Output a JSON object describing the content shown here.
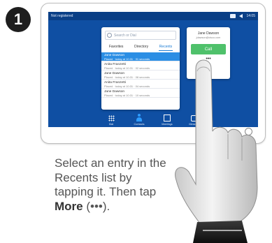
{
  "step": {
    "number": "1"
  },
  "tablet": {
    "status_bar": {
      "left": "Not registered",
      "time": "14:05"
    },
    "search": {
      "placeholder": "Search or Dial"
    },
    "tabs": [
      {
        "label": "Favorites",
        "active": false
      },
      {
        "label": "Directory",
        "active": false
      },
      {
        "label": "Recents",
        "active": true
      }
    ],
    "recents": [
      {
        "name": "Jane Dawson",
        "detail": "Placed · today at 10:31 · 01 seconds",
        "selected": true
      },
      {
        "name": "Anita Franzetti",
        "detail": "Placed · today at 10:31 · 02 seconds",
        "selected": false
      },
      {
        "name": "Jane Dawson",
        "detail": "Placed · today at 10:31 · 08 seconds",
        "selected": false
      },
      {
        "name": "Anita Franzetti",
        "detail": "Placed · today at 10:31 · 04 seconds",
        "selected": false
      },
      {
        "name": "Jane Dawson",
        "detail": "Placed · today at 10:31 · 10 seconds",
        "selected": false
      }
    ],
    "contact_card": {
      "name": "Jane Dawson",
      "uri": "jdawson@cisco.com",
      "call_label": "Call",
      "more_label": "•••"
    },
    "dock": [
      {
        "label": "Dial",
        "icon": "keypad-icon"
      },
      {
        "label": "Contacts",
        "icon": "contacts-icon"
      },
      {
        "label": "Meetings",
        "icon": "calendar-icon"
      },
      {
        "label": "Messages",
        "icon": "messages-icon"
      }
    ]
  },
  "instruction": {
    "text_before": "Select an entry in the Recents list by tapping it. Then tap ",
    "more_word": "More",
    "text_after": "(•••)."
  },
  "colors": {
    "screen": "#0f4fa3",
    "selected": "#2b8ee4",
    "call": "#4fc16b",
    "badge": "#1e1e1e"
  }
}
